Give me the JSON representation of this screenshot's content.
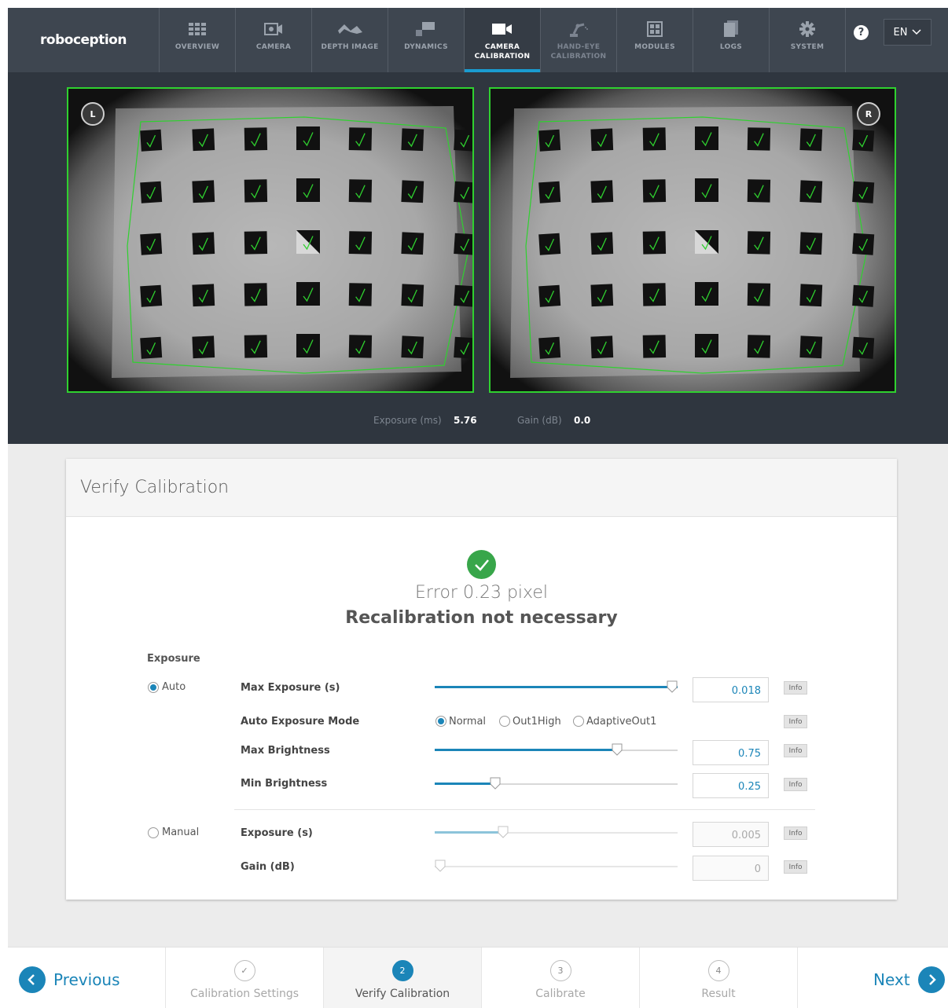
{
  "app": {
    "logo_text": "roboception",
    "language": "EN",
    "help_label": "?"
  },
  "nav_tabs": [
    {
      "label": "OVERVIEW",
      "icon": "grid-icon"
    },
    {
      "label": "CAMERA",
      "icon": "camera-icon"
    },
    {
      "label": "DEPTH IMAGE",
      "icon": "depth-icon"
    },
    {
      "label": "DYNAMICS",
      "icon": "dynamics-icon"
    },
    {
      "label": "CAMERA\nCALIBRATION",
      "icon": "video-camera-icon",
      "active": true
    },
    {
      "label": "HAND-EYE\nCALIBRATION",
      "icon": "robot-arm-icon"
    },
    {
      "label": "MODULES",
      "icon": "modules-icon"
    },
    {
      "label": "LOGS",
      "icon": "logs-icon"
    },
    {
      "label": "SYSTEM",
      "icon": "gear-icon"
    }
  ],
  "camera": {
    "left_badge": "L",
    "right_badge": "R",
    "exposure_label": "Exposure (ms)",
    "exposure_value": "5.76",
    "gain_label": "Gain (dB)",
    "gain_value": "0.0",
    "frame_color": "#2fd12f"
  },
  "verify": {
    "title": "Verify Calibration",
    "error_text": "Error 0.23 pixel",
    "status_text": "Recalibration not necessary",
    "success_color": "#38a64a"
  },
  "exposure": {
    "section_label": "Exposure",
    "auto_label": "Auto",
    "manual_label": "Manual",
    "mode": "Auto",
    "max_exposure": {
      "label": "Max Exposure (s)",
      "value": "0.018",
      "fraction": 1.0
    },
    "auto_exposure_mode": {
      "label": "Auto Exposure Mode",
      "options": [
        "Normal",
        "Out1High",
        "AdaptiveOut1"
      ],
      "selected": "Normal"
    },
    "max_brightness": {
      "label": "Max Brightness",
      "value": "0.75",
      "fraction": 0.75
    },
    "min_brightness": {
      "label": "Min Brightness",
      "value": "0.25",
      "fraction": 0.25
    },
    "manual_exposure": {
      "label": "Exposure (s)",
      "value": "0.005",
      "fraction": 0.28
    },
    "manual_gain": {
      "label": "Gain (dB)",
      "value": "0",
      "fraction": 0.0
    },
    "info_label": "Info"
  },
  "wizard": {
    "previous_label": "Previous",
    "next_label": "Next",
    "steps": [
      {
        "name": "Calibration Settings",
        "number": "✓",
        "state": "done"
      },
      {
        "name": "Verify Calibration",
        "number": "2",
        "state": "current"
      },
      {
        "name": "Calibrate",
        "number": "3",
        "state": "todo"
      },
      {
        "name": "Result",
        "number": "4",
        "state": "todo"
      }
    ]
  },
  "colors": {
    "accent": "#1b85b8",
    "nav_bg": "#3e4650",
    "active_tab_underline": "#1a9bd0"
  }
}
